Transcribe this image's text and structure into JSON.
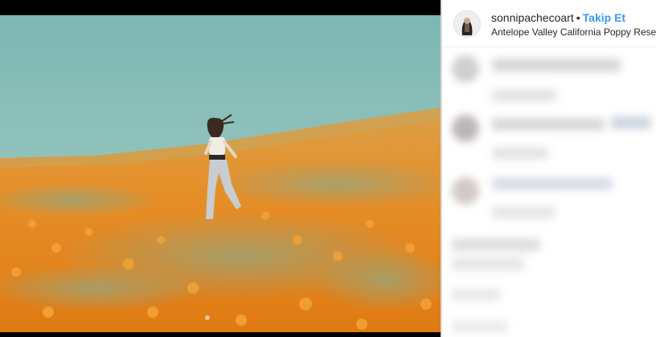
{
  "post": {
    "username": "sonnipachecoart",
    "separator": "•",
    "follow_label": "Takip Et",
    "location": "Antelope Valley California Poppy Reserve"
  },
  "colors": {
    "sky": "#8fbfb7",
    "poppy_orange": "#e98a1c",
    "follow_blue": "#3897f0"
  },
  "icons": [
    "avatar-photo"
  ]
}
